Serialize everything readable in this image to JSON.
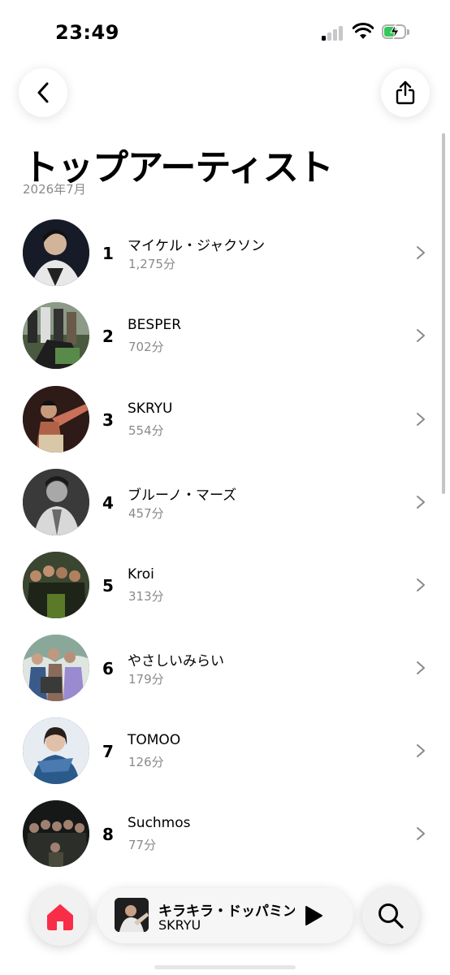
{
  "status_bar": {
    "time": "23:49",
    "icons": [
      "cellular-signal-icon",
      "wifi-icon",
      "battery-charging-icon"
    ],
    "battery_color": "#34c759"
  },
  "nav": {
    "back_icon": "chevron-left-icon",
    "share_icon": "share-icon"
  },
  "page": {
    "title": "トップアーティスト",
    "subtitle": "2026年7月"
  },
  "artists": [
    {
      "rank": "1",
      "name": "マイケル・ジャクソン",
      "minutes": "1,275分",
      "avatar_color": "#1c2230"
    },
    {
      "rank": "2",
      "name": "BESPER",
      "minutes": "702分",
      "avatar_color": "#2c3a2a"
    },
    {
      "rank": "3",
      "name": "SKRYU",
      "minutes": "554分",
      "avatar_color": "#3a2420"
    },
    {
      "rank": "4",
      "name": "ブルーノ・マーズ",
      "minutes": "457分",
      "avatar_color": "#4a4a4a"
    },
    {
      "rank": "5",
      "name": "Kroi",
      "minutes": "313分",
      "avatar_color": "#2e3424"
    },
    {
      "rank": "6",
      "name": "やさしいみらい",
      "minutes": "179分",
      "avatar_color": "#5a6a70"
    },
    {
      "rank": "7",
      "name": "TOMOO",
      "minutes": "126分",
      "avatar_color": "#c9d2dc"
    },
    {
      "rank": "8",
      "name": "Suchmos",
      "minutes": "77分",
      "avatar_color": "#1e2220"
    }
  ],
  "mini_player": {
    "title": "キラキラ・ドッパミン",
    "artist": "SKRYU",
    "play_icon": "play-icon"
  },
  "tab_bar": {
    "home_icon": "home-icon",
    "search_icon": "search-icon",
    "accent_color": "#fa2d48"
  }
}
